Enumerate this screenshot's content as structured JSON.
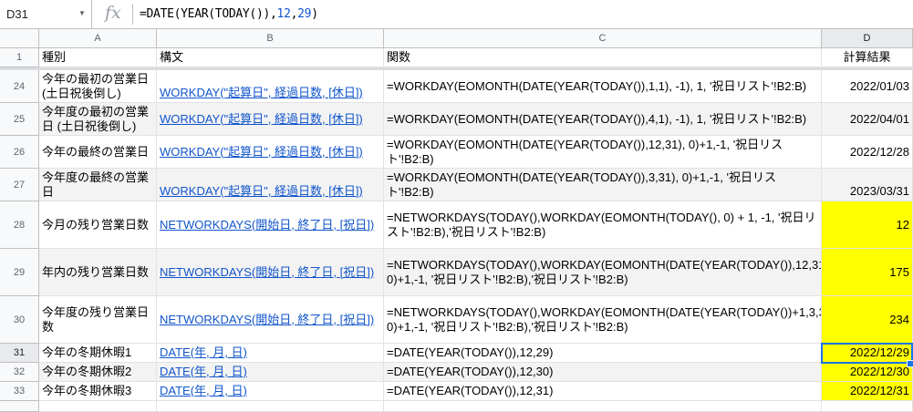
{
  "formula_bar": {
    "name_box": "D31",
    "fx_label": "fx",
    "formula_prefix": "=DATE(YEAR(TODAY()),",
    "formula_n1": "12",
    "formula_comma": ",",
    "formula_n2": "29",
    "formula_suffix": ")"
  },
  "columns": [
    "A",
    "B",
    "C",
    "D"
  ],
  "header_row": {
    "num": "1",
    "a": "種別",
    "b": "構文",
    "c": "関数",
    "d": "計算結果"
  },
  "rows": [
    {
      "num": "24",
      "a": "今年の最初の営業日(土日祝後倒し)",
      "b": "WORKDAY(\"起算日\", 経過日数, [休日])",
      "c": "=WORKDAY(EOMONTH(DATE(YEAR(TODAY()),1,1), -1), 1, '祝日リスト'!B2:B)",
      "d": "2022/01/03"
    },
    {
      "num": "25",
      "a": "今年度の最初の営業日 (土日祝後倒し)",
      "b": "WORKDAY(\"起算日\", 経過日数, [休日])",
      "c": "=WORKDAY(EOMONTH(DATE(YEAR(TODAY()),4,1), -1), 1, '祝日リスト'!B2:B)",
      "d": "2022/04/01"
    },
    {
      "num": "26",
      "a": "今年の最終の営業日",
      "b": "WORKDAY(\"起算日\", 経過日数, [休日])",
      "c": "=WORKDAY(EOMONTH(DATE(YEAR(TODAY()),12,31), 0)+1,-1, '祝日リスト'!B2:B)",
      "d": "2022/12/28"
    },
    {
      "num": "27",
      "a": "今年度の最終の営業日",
      "b": "WORKDAY(\"起算日\", 経過日数, [休日])",
      "c": "=WORKDAY(EOMONTH(DATE(YEAR(TODAY()),3,31), 0)+1,-1, '祝日リスト'!B2:B)",
      "d": "2023/03/31"
    },
    {
      "num": "28",
      "a": "今月の残り営業日数",
      "b": "NETWORKDAYS(開始日, 終了日, [祝日])",
      "c": "=NETWORKDAYS(TODAY(),WORKDAY(EOMONTH(TODAY(), 0) + 1, -1, '祝日リスト'!B2:B),'祝日リスト'!B2:B)",
      "d": "12"
    },
    {
      "num": "29",
      "a": "年内の残り営業日数",
      "b": "NETWORKDAYS(開始日, 終了日, [祝日])",
      "c": "=NETWORKDAYS(TODAY(),WORKDAY(EOMONTH(DATE(YEAR(TODAY()),12,31), 0)+1,-1, '祝日リスト'!B2:B),'祝日リスト'!B2:B)",
      "d": "175"
    },
    {
      "num": "30",
      "a": "今年度の残り営業日数",
      "b": "NETWORKDAYS(開始日, 終了日, [祝日])",
      "c": "=NETWORKDAYS(TODAY(),WORKDAY(EOMONTH(DATE(YEAR(TODAY())+1,3,31), 0)+1,-1, '祝日リスト'!B2:B),'祝日リスト'!B2:B)",
      "d": "234"
    },
    {
      "num": "31",
      "a": "今年の冬期休暇1",
      "b": "DATE(年, 月, 日)",
      "c": "=DATE(YEAR(TODAY()),12,29)",
      "d": "2022/12/29"
    },
    {
      "num": "32",
      "a": "今年の冬期休暇2",
      "b": "DATE(年, 月, 日)",
      "c": "=DATE(YEAR(TODAY()),12,30)",
      "d": "2022/12/30"
    },
    {
      "num": "33",
      "a": "今年の冬期休暇3",
      "b": "DATE(年, 月, 日)",
      "c": "=DATE(YEAR(TODAY()),12,31)",
      "d": "2022/12/31"
    }
  ],
  "colors": {
    "highlight": "#ffff00",
    "link": "#1155cc",
    "selection": "#1a73e8"
  }
}
